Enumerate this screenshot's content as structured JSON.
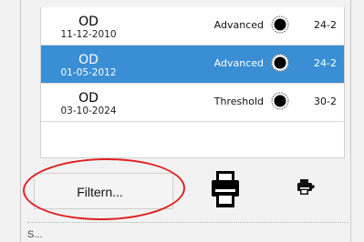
{
  "exams": [
    {
      "eye": "OD",
      "date": "11-12-2010",
      "strategy": "Advanced",
      "test": "24-2",
      "selected": false
    },
    {
      "eye": "OD",
      "date": "01-05-2012",
      "strategy": "Advanced",
      "test": "24-2",
      "selected": true
    },
    {
      "eye": "OD",
      "date": "03-10-2024",
      "strategy": "Threshold",
      "test": "30-2",
      "selected": false
    }
  ],
  "toolbar": {
    "filter_label": "Filtern...",
    "print_icon": "printer-icon",
    "print_small_icon": "printer-settings-icon"
  },
  "bottom": {
    "label": "S..."
  },
  "colors": {
    "selection": "#3a8ed3",
    "highlight_ring": "#e02020"
  }
}
